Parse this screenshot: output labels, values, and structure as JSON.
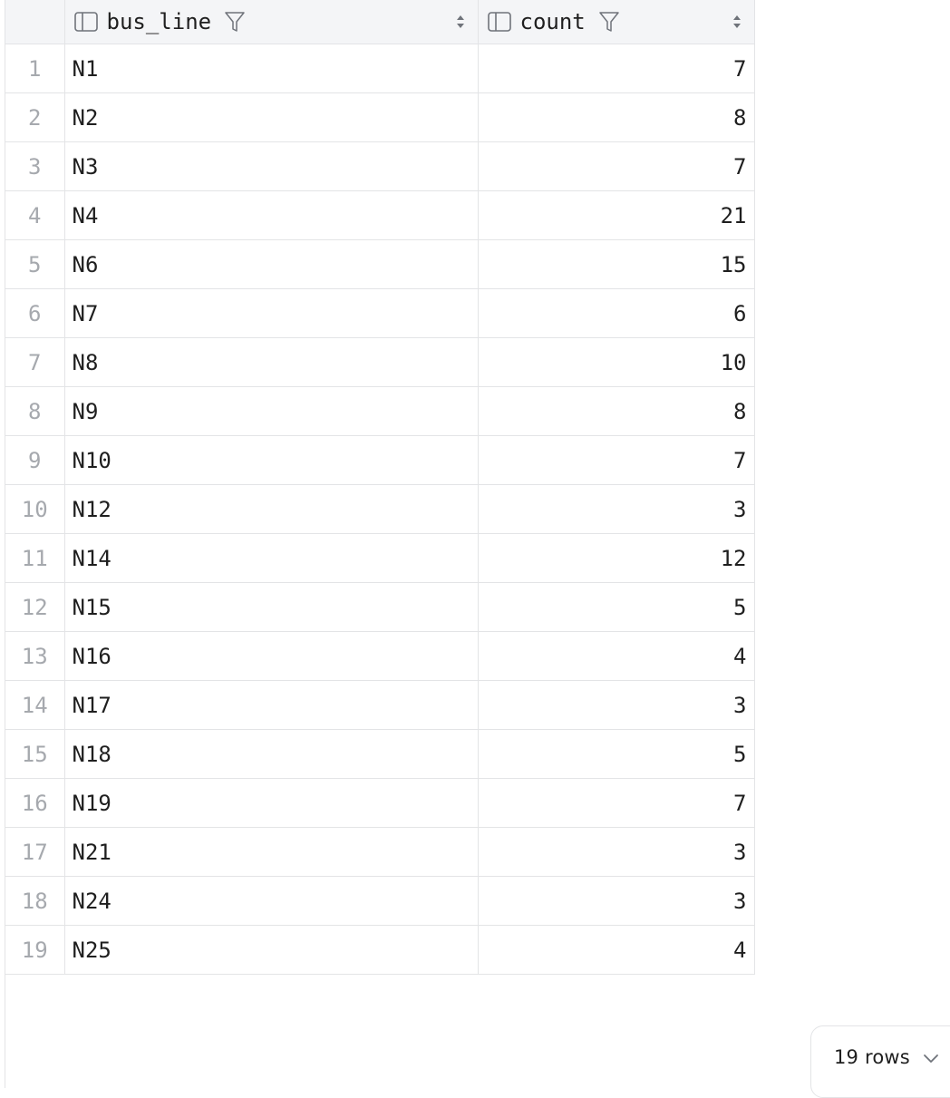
{
  "columns": [
    {
      "name": "bus_line",
      "icon": "column-icon",
      "filter_icon": "filter-icon",
      "sort_icon": "sort-icon"
    },
    {
      "name": "count",
      "icon": "column-icon",
      "filter_icon": "filter-icon",
      "sort_icon": "sort-icon"
    }
  ],
  "rows": [
    {
      "index": "1",
      "bus_line": "N1",
      "count": "7"
    },
    {
      "index": "2",
      "bus_line": "N2",
      "count": "8"
    },
    {
      "index": "3",
      "bus_line": "N3",
      "count": "7"
    },
    {
      "index": "4",
      "bus_line": "N4",
      "count": "21"
    },
    {
      "index": "5",
      "bus_line": "N6",
      "count": "15"
    },
    {
      "index": "6",
      "bus_line": "N7",
      "count": "6"
    },
    {
      "index": "7",
      "bus_line": "N8",
      "count": "10"
    },
    {
      "index": "8",
      "bus_line": "N9",
      "count": "8"
    },
    {
      "index": "9",
      "bus_line": "N10",
      "count": "7"
    },
    {
      "index": "10",
      "bus_line": "N12",
      "count": "3"
    },
    {
      "index": "11",
      "bus_line": "N14",
      "count": "12"
    },
    {
      "index": "12",
      "bus_line": "N15",
      "count": "5"
    },
    {
      "index": "13",
      "bus_line": "N16",
      "count": "4"
    },
    {
      "index": "14",
      "bus_line": "N17",
      "count": "3"
    },
    {
      "index": "15",
      "bus_line": "N18",
      "count": "5"
    },
    {
      "index": "16",
      "bus_line": "N19",
      "count": "7"
    },
    {
      "index": "17",
      "bus_line": "N21",
      "count": "3"
    },
    {
      "index": "18",
      "bus_line": "N24",
      "count": "3"
    },
    {
      "index": "19",
      "bus_line": "N25",
      "count": "4"
    }
  ],
  "footer": {
    "rows_label": "19 rows",
    "dropdown_icon": "chevron-down-icon"
  },
  "colors": {
    "header_bg": "#f4f5f7",
    "grid_line": "#e3e4e6",
    "row_number": "#a6a9ae",
    "text": "#1f1f1f"
  }
}
